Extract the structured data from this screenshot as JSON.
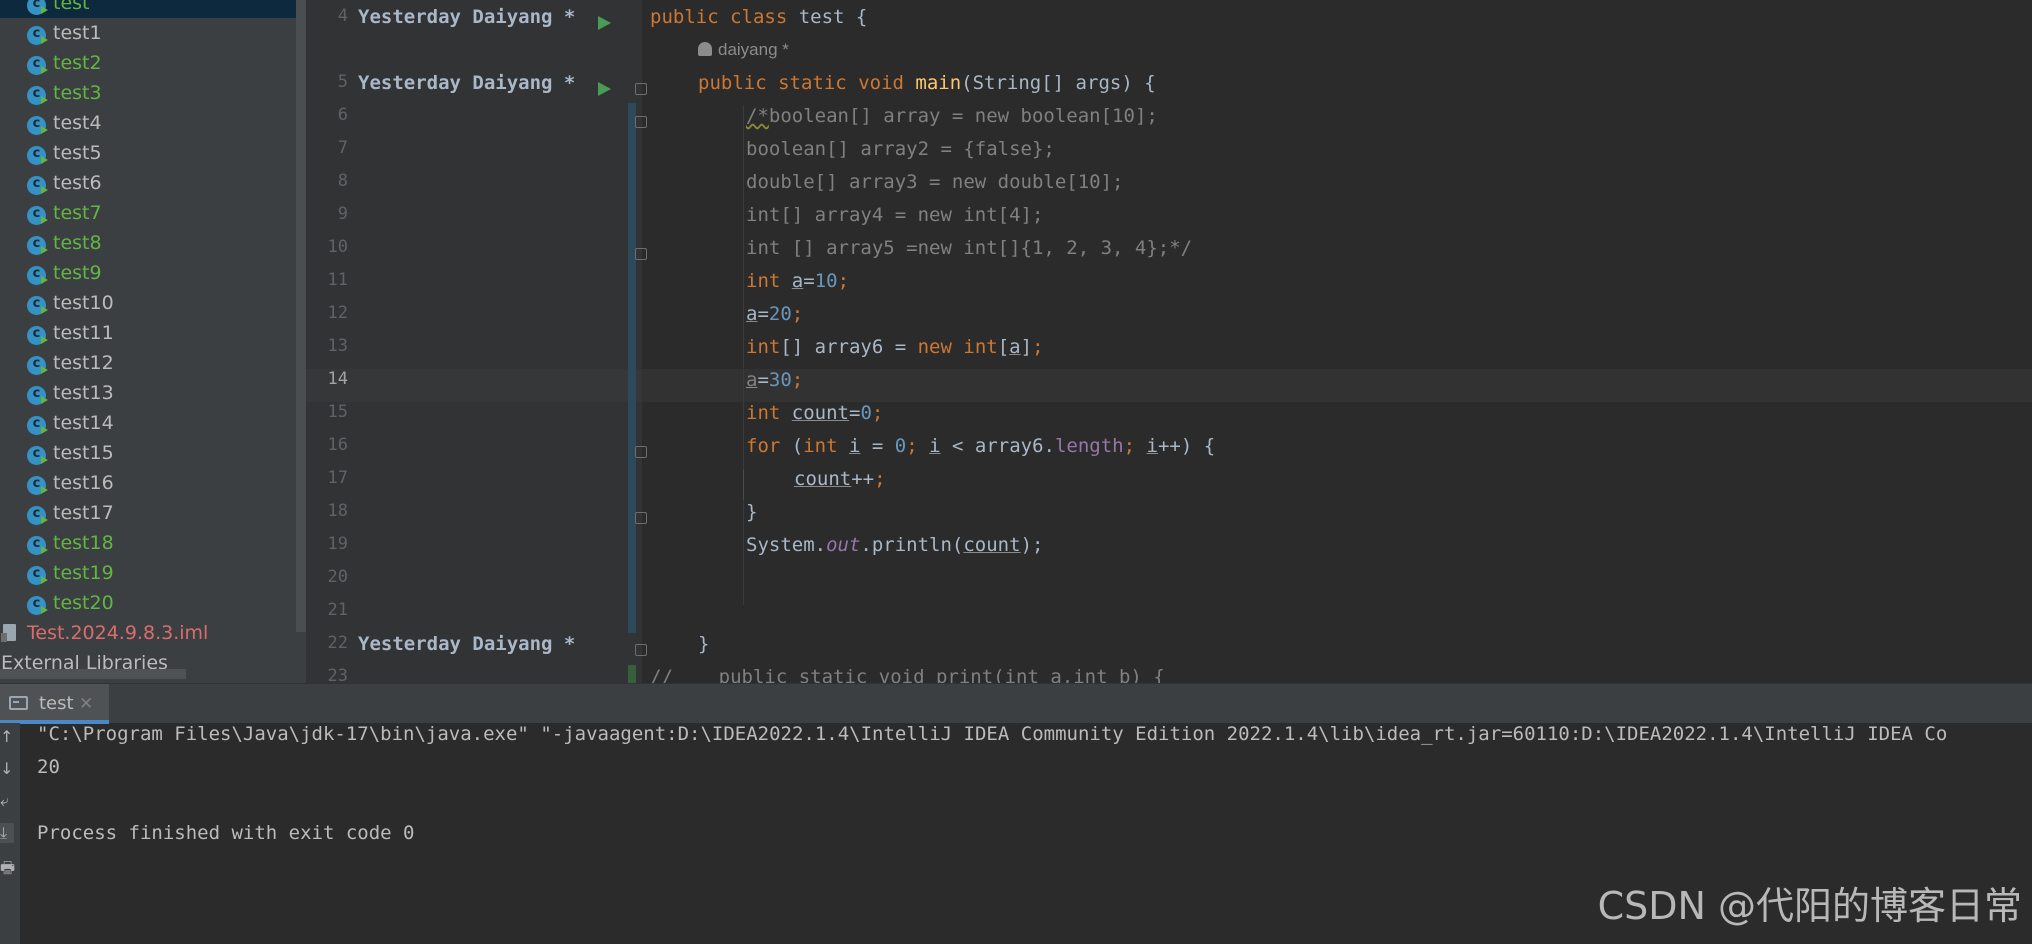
{
  "project_tree": {
    "items": [
      {
        "label": "test",
        "status": "selected"
      },
      {
        "label": "test1",
        "status": "normal"
      },
      {
        "label": "test2",
        "status": "added"
      },
      {
        "label": "test3",
        "status": "added"
      },
      {
        "label": "test4",
        "status": "normal"
      },
      {
        "label": "test5",
        "status": "normal"
      },
      {
        "label": "test6",
        "status": "normal"
      },
      {
        "label": "test7",
        "status": "added"
      },
      {
        "label": "test8",
        "status": "added"
      },
      {
        "label": "test9",
        "status": "added"
      },
      {
        "label": "test10",
        "status": "normal"
      },
      {
        "label": "test11",
        "status": "normal"
      },
      {
        "label": "test12",
        "status": "normal"
      },
      {
        "label": "test13",
        "status": "normal"
      },
      {
        "label": "test14",
        "status": "normal"
      },
      {
        "label": "test15",
        "status": "normal"
      },
      {
        "label": "test16",
        "status": "normal"
      },
      {
        "label": "test17",
        "status": "normal"
      },
      {
        "label": "test18",
        "status": "added"
      },
      {
        "label": "test19",
        "status": "added"
      },
      {
        "label": "test20",
        "status": "added"
      }
    ],
    "iml_file": "Test.2024.9.8.3.iml",
    "external_libraries": "External Libraries"
  },
  "editor": {
    "blame": {
      "line4": "Yesterday Daiyang *",
      "line5": "Yesterday Daiyang *",
      "line22": "Yesterday Daiyang *"
    },
    "inlay_author": "daiyang *",
    "line_numbers": [
      "4",
      "5",
      "6",
      "7",
      "8",
      "9",
      "10",
      "11",
      "12",
      "13",
      "14",
      "15",
      "16",
      "17",
      "18",
      "19",
      "20",
      "21",
      "22",
      "23"
    ],
    "current_line": "14",
    "code": {
      "l4": {
        "kw_public": "public",
        "kw_class": "class",
        "rest": " test {"
      },
      "l5": {
        "kw_public": "public",
        "kw_static": "static",
        "kw_void": "void",
        "name": "main",
        "rest": "(String[] args) {"
      },
      "l6": {
        "comment_start": "/*",
        "comment_rest": "boolean[] array = new boolean[10];"
      },
      "l7": "boolean[] array2 = {false};",
      "l8": "double[] array3 = new double[10];",
      "l9": "int[] array4 = new int[4];",
      "l10": "int [] array5 =new int[]{1, 2, 3, 4};*/",
      "l11": {
        "kw": "int",
        "var": "a",
        "eq": "=",
        "num": "10",
        "semi": ";"
      },
      "l12": {
        "var": "a",
        "eq": "=",
        "num": "20",
        "semi": ";"
      },
      "l13": {
        "kw_int": "int",
        "mid": "[] array6 = ",
        "kw_new": "new",
        "kw_int2": "int",
        "lb": "[",
        "var": "a",
        "rb": "]",
        "semi": ";"
      },
      "l14": {
        "var": "a",
        "eq": "=",
        "num": "30",
        "semi": ";"
      },
      "l15": {
        "kw": "int",
        "var": "count",
        "eq": "=",
        "num": "0",
        "semi": ";"
      },
      "l16": {
        "kw_for": "for",
        "p1": " (",
        "kw_int": "int",
        "var_i": "i",
        "p2": " = ",
        "num": "0",
        "semi1": ";",
        "var_i2": "i",
        "p3": " < array6.",
        "field": "length",
        "semi2": ";",
        "var_i3": "i",
        "p4": "++) {"
      },
      "l17": {
        "var": "count",
        "rest": "++",
        "semi": ";"
      },
      "l18": "}",
      "l19": {
        "sys": "System.",
        "out": "out",
        "call": ".println(",
        "var": "count",
        "end": ");",
        "semi": ""
      },
      "l22": "}",
      "l23": "//    public static void print(int a,int b) {"
    }
  },
  "run_panel": {
    "tab_label": "test",
    "close_glyph": "✕",
    "toolbar_icons": [
      "↑",
      "↓",
      "⤶",
      "⤓",
      "🖶"
    ],
    "console": [
      "\"C:\\Program Files\\Java\\jdk-17\\bin\\java.exe\" \"-javaagent:D:\\IDEA2022.1.4\\IntelliJ IDEA Community Edition 2022.1.4\\lib\\idea_rt.jar=60110:D:\\IDEA2022.1.4\\IntelliJ IDEA Co",
      "20",
      "",
      "Process finished with exit code 0"
    ]
  },
  "watermark": "CSDN @代阳的博客日常",
  "colors": {
    "keyword": "#cc7832",
    "number": "#6897bb",
    "comment": "#808080",
    "method": "#ffc66d",
    "field": "#9876aa",
    "vcs_added": "#62b543",
    "accent": "#4a88c7"
  }
}
